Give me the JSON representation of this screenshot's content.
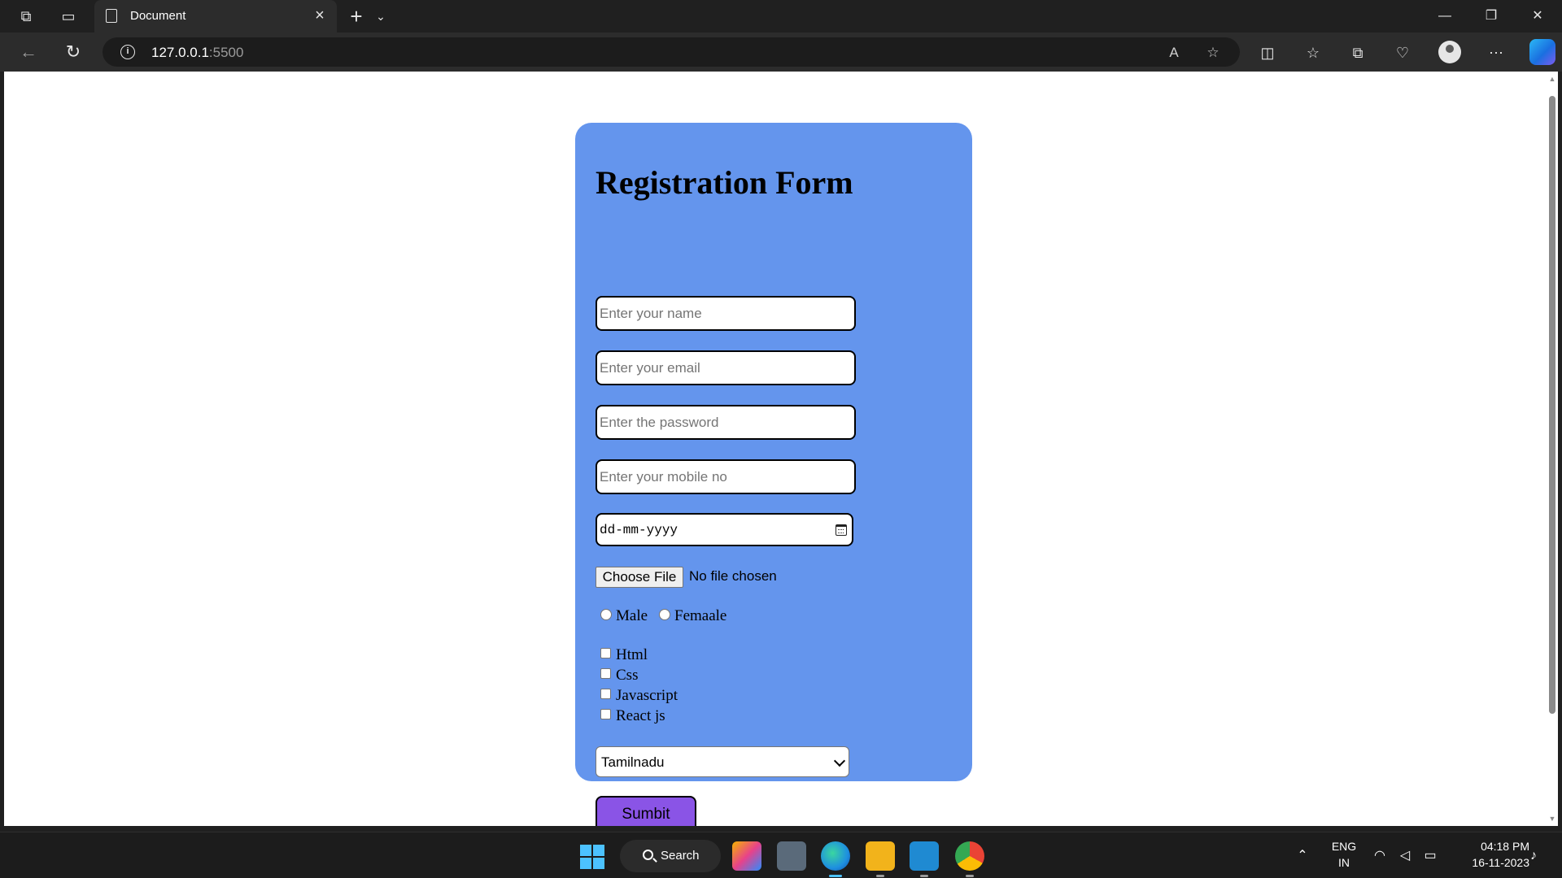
{
  "browser": {
    "tab": {
      "title": "Document"
    },
    "address": {
      "host": "127.0.0.1",
      "port": ":5500"
    }
  },
  "form": {
    "title": "Registration Form",
    "name_placeholder": "Enter your name",
    "email_placeholder": "Enter your email",
    "password_placeholder": "Enter the password",
    "mobile_placeholder": "Enter your mobile no",
    "date_placeholder": "dd-mm-yyyy",
    "file_button": "Choose File",
    "file_status": "No file chosen",
    "gender_options": [
      "Male",
      "Femaale"
    ],
    "skills": [
      "Html",
      "Css",
      "Javascript",
      "React js"
    ],
    "state_selected": "Tamilnadu",
    "submit_label": "Sumbit"
  },
  "taskbar": {
    "search_label": "Search",
    "language": "ENG",
    "region": "IN",
    "time": "04:18 PM",
    "date": "16-11-2023"
  },
  "colors": {
    "card_background": "#6495ed",
    "submit_background": "#8a54e6",
    "page_background": "#ffffff"
  }
}
